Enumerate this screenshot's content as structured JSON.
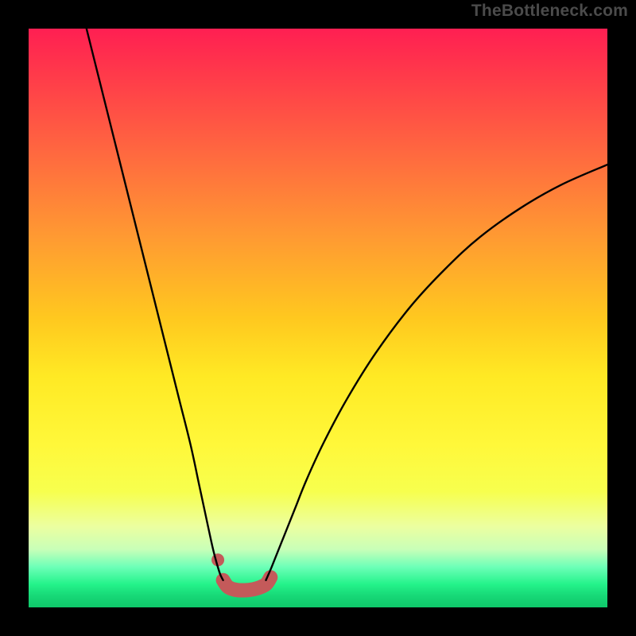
{
  "watermark": "TheBottleneck.com",
  "chart_data": {
    "type": "line",
    "title": "",
    "xlabel": "",
    "ylabel": "",
    "xlim": [
      0,
      100
    ],
    "ylim": [
      0,
      100
    ],
    "grid": false,
    "legend": false,
    "annotations": [],
    "series": [
      {
        "name": "left-branch",
        "color": "#000000",
        "x": [
          10.0,
          12.0,
          14.0,
          16.0,
          18.0,
          20.0,
          22.0,
          24.0,
          26.0,
          28.0,
          29.5,
          31.0,
          32.0,
          33.0,
          33.6
        ],
        "y": [
          100.0,
          92.0,
          84.0,
          76.0,
          68.0,
          60.0,
          52.0,
          44.0,
          36.0,
          28.0,
          21.0,
          14.0,
          9.5,
          6.0,
          4.7
        ]
      },
      {
        "name": "right-branch",
        "color": "#000000",
        "x": [
          41.0,
          42.0,
          44.0,
          46.0,
          48.0,
          51.0,
          55.0,
          60.0,
          66.0,
          72.0,
          78.0,
          85.0,
          92.0,
          100.0
        ],
        "y": [
          4.7,
          7.0,
          12.0,
          17.0,
          22.0,
          28.5,
          36.0,
          44.0,
          52.0,
          58.5,
          64.0,
          69.0,
          73.0,
          76.5
        ]
      },
      {
        "name": "valley-marker",
        "color": "#c45a5a",
        "x": [
          33.6,
          34.5,
          36.0,
          38.0,
          39.5,
          41.0,
          41.8
        ],
        "y": [
          4.7,
          3.5,
          3.0,
          3.0,
          3.3,
          4.0,
          5.2
        ]
      }
    ],
    "markers": [
      {
        "name": "valley-dot",
        "x": 32.7,
        "y": 8.2,
        "color": "#c45a5a"
      }
    ],
    "background_gradient": {
      "direction": "vertical",
      "stops": [
        {
          "pos": 0.0,
          "color": "#ff1f52"
        },
        {
          "pos": 0.5,
          "color": "#ffc81f"
        },
        {
          "pos": 0.8,
          "color": "#f7ff4e"
        },
        {
          "pos": 0.93,
          "color": "#6dffb8"
        },
        {
          "pos": 1.0,
          "color": "#0fc86a"
        }
      ]
    }
  }
}
